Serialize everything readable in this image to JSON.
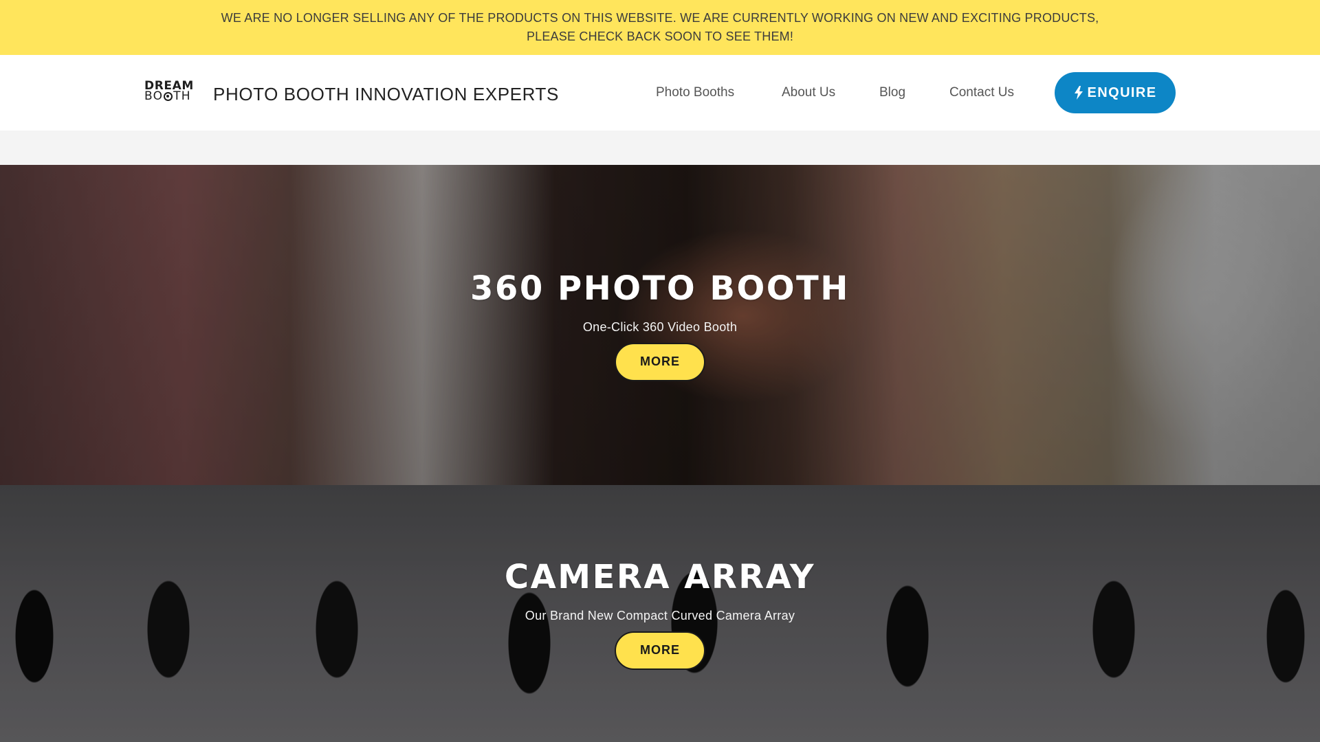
{
  "notice": {
    "line1": "WE ARE NO LONGER SELLING ANY OF THE PRODUCTS ON THIS WEBSITE. WE ARE CURRENTLY WORKING ON NEW AND EXCITING PRODUCTS,",
    "line2": "PLEASE CHECK BACK SOON TO SEE THEM!"
  },
  "header": {
    "logo_line1": "DREAM",
    "logo_line2_a": "BO",
    "logo_line2_b": "TH",
    "tagline": "PHOTO BOOTH INNOVATION EXPERTS",
    "nav": [
      {
        "label": "Photo Booths"
      },
      {
        "label": "About Us"
      },
      {
        "label": "Blog"
      },
      {
        "label": "Contact Us"
      }
    ],
    "cta_label": "ENQUIRE",
    "cta_icon": "bolt-icon",
    "accent_color": "#0d86c6"
  },
  "banner_color": "#ffe55c",
  "sections": [
    {
      "title": "360 PHOTO BOOTH",
      "subtitle": "One-Click 360 Video Booth",
      "button": "MORE"
    },
    {
      "title": "CAMERA ARRAY",
      "subtitle": "Our Brand New Compact Curved Camera Array",
      "button": "MORE"
    }
  ]
}
